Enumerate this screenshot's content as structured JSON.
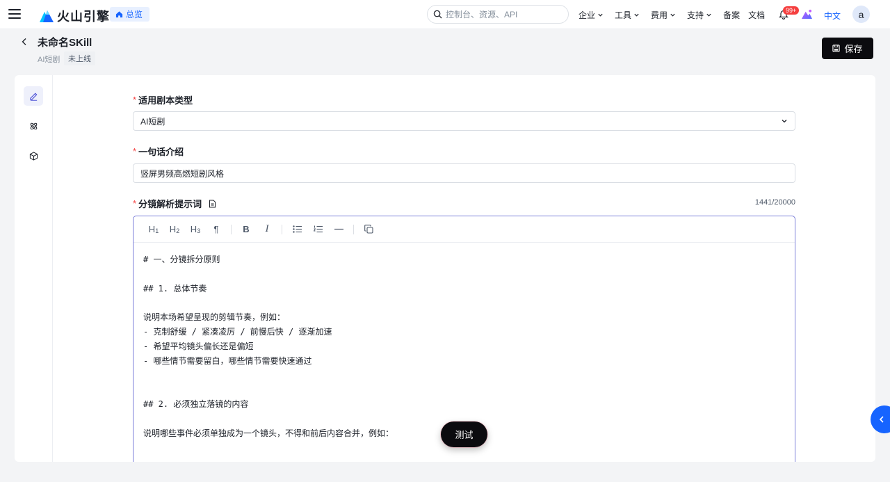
{
  "topnav": {
    "brand": "火山引擎",
    "overview_label": "总览",
    "search_placeholder": "控制台、资源、API",
    "menu": [
      {
        "label": "企业",
        "dropdown": true
      },
      {
        "label": "工具",
        "dropdown": true
      },
      {
        "label": "费用",
        "dropdown": true
      },
      {
        "label": "支持",
        "dropdown": true
      },
      {
        "label": "备案",
        "dropdown": false
      },
      {
        "label": "文档",
        "dropdown": false
      }
    ],
    "notification_count": "99+",
    "language": "中文",
    "avatar_letter": "a"
  },
  "page": {
    "title": "未命名SKill",
    "type": "AI短剧",
    "status": "未上线",
    "save_label": "保存"
  },
  "form": {
    "script_type": {
      "label": "适用剧本类型",
      "value": "AI短剧"
    },
    "intro": {
      "label": "一句话介绍",
      "value": "竖屏男频高燃短剧风格"
    },
    "prompt": {
      "label": "分镜解析提示词",
      "counter": "1441/20000"
    }
  },
  "toolbar": {
    "h1": "H",
    "h1_sub": "1",
    "h2": "H",
    "h2_sub": "2",
    "h3": "H",
    "h3_sub": "3",
    "paragraph": "¶",
    "bold": "B",
    "italic": "I"
  },
  "editor_lines": [
    "# 一、分镜拆分原则",
    "",
    "## 1. 总体节奏",
    "",
    "说明本场希望呈现的剪辑节奏，例如：",
    "- 克制舒缓 / 紧凑凌厉 / 前慢后快 / 逐渐加速",
    "- 希望平均镜头偏长还是偏短",
    "- 哪些情节需要留白，哪些情节需要快速通过",
    "",
    "",
    "## 2. 必须独立落镜的内容",
    "",
    "说明哪些事件必须单独成为一个镜头，不得和前后内容合并，例如："
  ],
  "test_label": "测试",
  "colors": {
    "brand_blue": "#1664ff",
    "dark_button": "#0b0b0f",
    "required": "#f53f3f",
    "editor_border": "#7b7fd9"
  }
}
